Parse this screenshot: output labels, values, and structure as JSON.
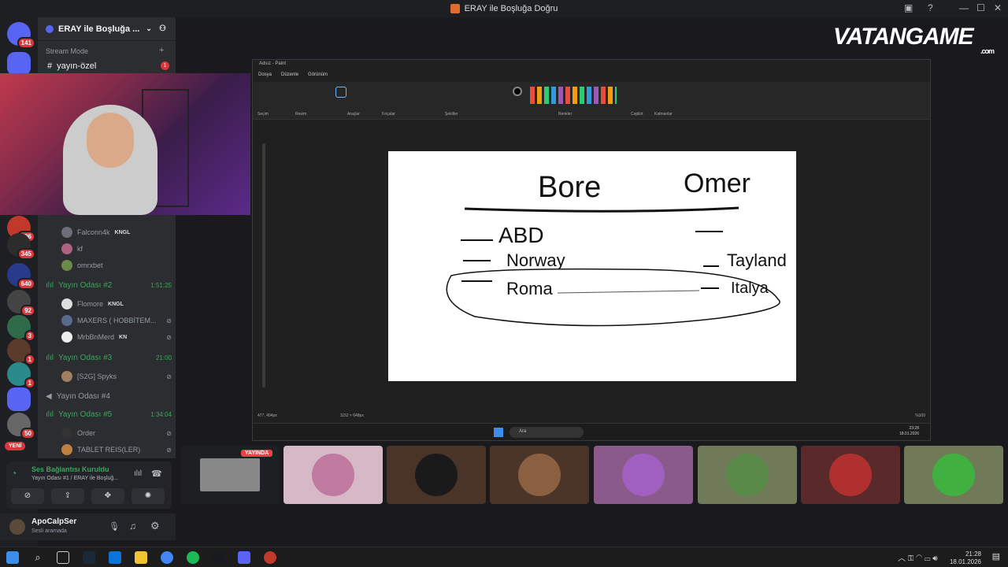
{
  "window": {
    "title": "ERAY ile Boşluğa Doğru"
  },
  "server_list": {
    "badges": [
      "141",
      "696",
      "345",
      "640",
      "92",
      "3",
      "1",
      "1",
      "50"
    ],
    "new_label": "YENİ"
  },
  "channel_panel": {
    "server_name": "ERAY ile Boşluğa ...",
    "stream_mode": "Stream Mode",
    "text_channel": "yayın-özel",
    "text_channel_badge": "1",
    "users_top": [
      {
        "name": "Falconn4k",
        "tag": "KNGL"
      },
      {
        "name": "kf",
        "tag": ""
      },
      {
        "name": "omrxbet",
        "tag": ""
      }
    ],
    "voice_channels": [
      {
        "name": "Yayın Odası #2",
        "time": "1:51:25",
        "users": [
          {
            "name": "Flomore",
            "tag": "KNGL"
          },
          {
            "name": "MAXERS ( HOBBİTEM...",
            "tag": ""
          },
          {
            "name": "MrbBnMerd",
            "tag": "KN"
          }
        ]
      },
      {
        "name": "Yayın Odası #3",
        "time": "21:00",
        "users": [
          {
            "name": "[S2G] Spyks",
            "tag": ""
          }
        ]
      },
      {
        "name": "Yayın Odası #4",
        "time": "",
        "users": []
      },
      {
        "name": "Yayın Odası #5",
        "time": "1:34:04",
        "users": [
          {
            "name": "Order",
            "tag": ""
          },
          {
            "name": "TABLET REIS(LER)",
            "tag": ""
          }
        ]
      }
    ]
  },
  "voice_status": {
    "title": "Ses Bağlantısı Kuruldu",
    "subtitle": "Yayın Odası #1 / ERAY ile Boşluğ..."
  },
  "user_panel": {
    "name": "ApoCalpSer",
    "status": "Sesli aramada"
  },
  "paint": {
    "title": "Adsız - Paint",
    "menu": [
      "Dosya",
      "Düzenle",
      "Görünüm"
    ],
    "ribbon_groups": [
      "Seçim",
      "Resim",
      "Araçlar",
      "Fırçalar",
      "Şekiller",
      "Renkler",
      "Copilot",
      "Katmanlar"
    ],
    "canvas_text": {
      "left_header": "Bore",
      "right_header": "Omer",
      "left_items": [
        "ABD",
        "Norway",
        "Roma"
      ],
      "right_items": [
        "",
        "Tayland",
        "Italya"
      ]
    },
    "status": {
      "cursor": "477, 404px",
      "size": "1152 × 648px",
      "zoom": "%100"
    },
    "inner_taskbar": {
      "search": "Ara",
      "time": "23:28",
      "date": "18.01.2026"
    }
  },
  "logo": {
    "text": "VATANGAME",
    "suffix": ".com"
  },
  "stream_tiles": {
    "live_label": "YAYINDA"
  },
  "taskbar": {
    "time": "21:28",
    "date": "18.01.2026"
  },
  "colors": {
    "discord_green": "#3ba55d",
    "badge_red": "#da373c",
    "logo_yellow": "#f4c61a"
  }
}
